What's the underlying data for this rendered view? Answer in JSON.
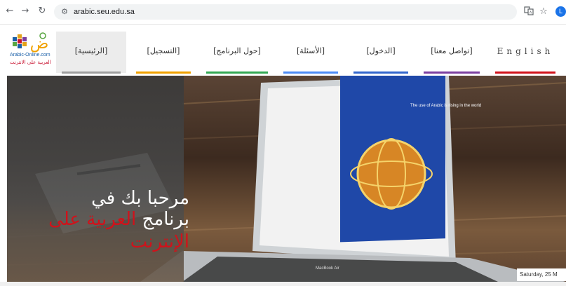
{
  "browser": {
    "url": "arabic.seu.edu.sa",
    "back_icon": "back-arrow-icon",
    "forward_icon": "forward-arrow-icon",
    "reload_icon": "reload-icon",
    "site_info_icon": "site-info-icon",
    "translate_icon": "translate-icon",
    "bookmark_icon": "star-icon",
    "profile_initial": "L"
  },
  "header": {
    "logo": {
      "line1": "Arabic-Online.com",
      "line2": "العربية على الانترنت",
      "glyph": "ض"
    },
    "nav": [
      {
        "label": "[الرئيسية]",
        "color": "#9e9e9e",
        "active": true
      },
      {
        "label": "[التسجيل]",
        "color": "#f0a100",
        "active": false
      },
      {
        "label": "[حول البرنامج]",
        "color": "#33a853",
        "active": false
      },
      {
        "label": "[الأسئلة]",
        "color": "#4c8bf5",
        "active": false
      },
      {
        "label": "[الدخول]",
        "color": "#3366cc",
        "active": false
      },
      {
        "label": "[تواصل معنا]",
        "color": "#7b3fa0",
        "active": false
      },
      {
        "label": "English",
        "color": "#d0121b",
        "active": false
      }
    ]
  },
  "hero": {
    "welcome_line1": "مرحبا بك في",
    "welcome_line2_a": "برنامج ",
    "welcome_line2_b": "العربية على",
    "welcome_line3": "الإنترنت",
    "laptop_caption": "The use of Arabic is rising in the world",
    "laptop_brand": "MacBook Air",
    "date": "Saturday, 25 M"
  }
}
